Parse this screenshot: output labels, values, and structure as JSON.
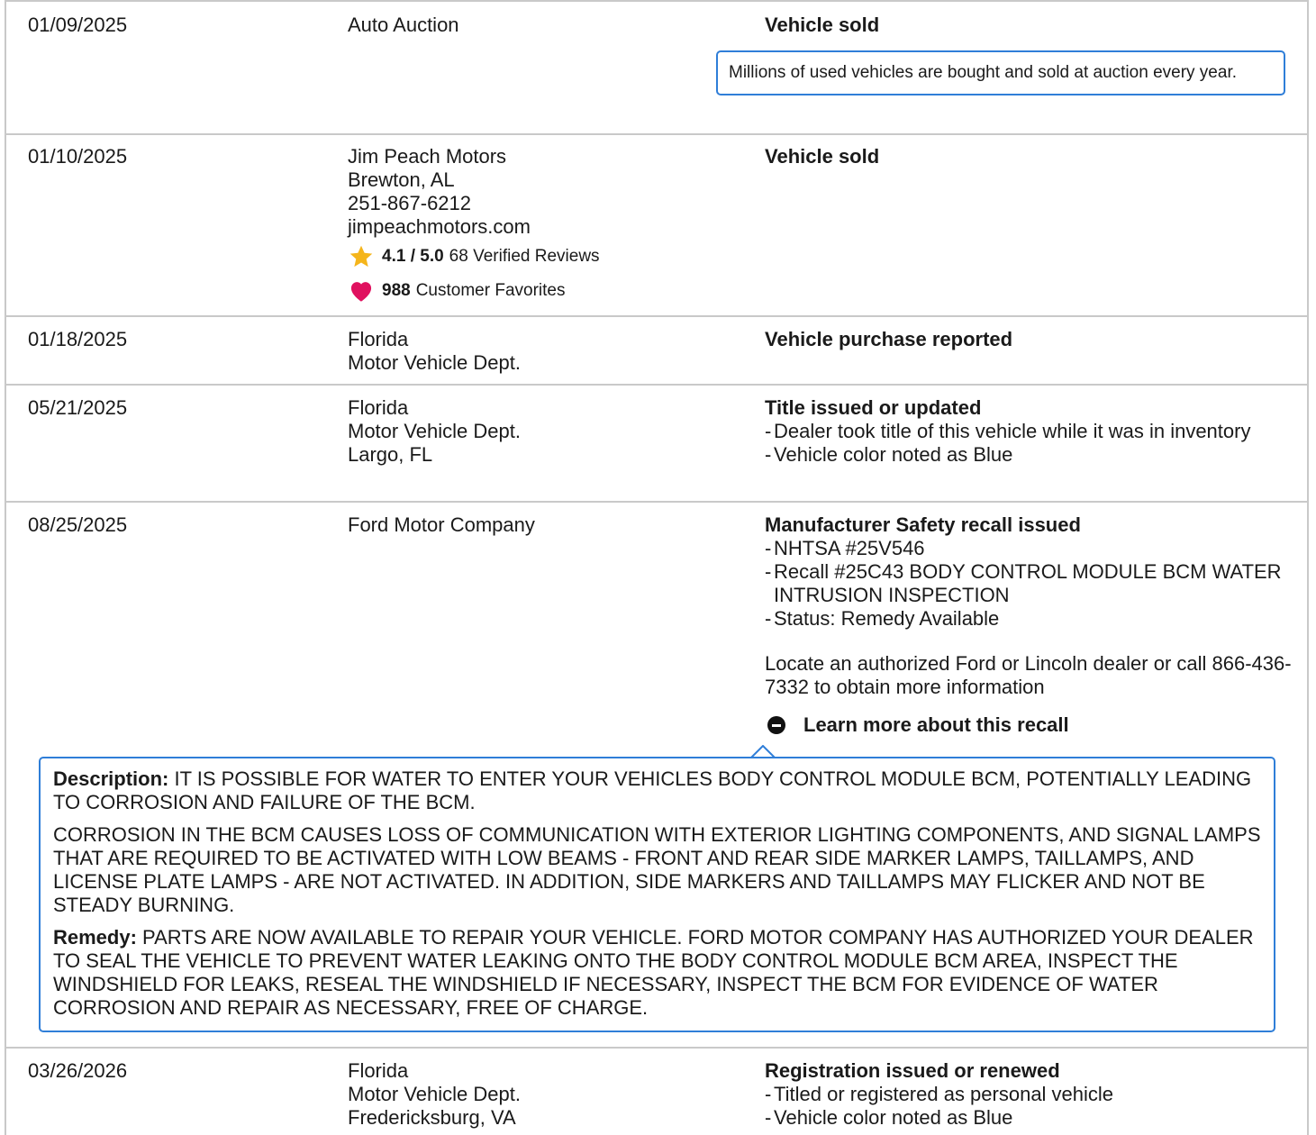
{
  "rows": [
    {
      "date": "01/09/2025",
      "source": [
        "Auto Auction"
      ],
      "title": "Vehicle sold",
      "note": "Millions of used vehicles are bought and sold at auction every year."
    },
    {
      "date": "01/10/2025",
      "source": [
        "Jim Peach Motors",
        "Brewton, AL",
        "251-867-6212",
        "jimpeachmotors.com"
      ],
      "rating": "4.1 / 5.0",
      "reviews": "68 Verified Reviews",
      "favorites_count": "988",
      "favorites_label": "Customer Favorites",
      "title": "Vehicle sold"
    },
    {
      "date": "01/18/2025",
      "source": [
        "Florida",
        "Motor Vehicle Dept."
      ],
      "title": "Vehicle purchase reported"
    },
    {
      "date": "05/21/2025",
      "source": [
        "Florida",
        "Motor Vehicle Dept.",
        "Largo, FL"
      ],
      "title": "Title issued or updated",
      "bullets": [
        "Dealer took title of this vehicle while it was in inventory",
        "Vehicle color noted as Blue"
      ]
    },
    {
      "date": "08/25/2025",
      "source": [
        "Ford Motor Company"
      ],
      "title": "Manufacturer Safety recall issued",
      "bullets": [
        "NHTSA #25V546",
        "Recall #25C43 BODY CONTROL MODULE BCM WATER INTRUSION INSPECTION",
        "Status: Remedy Available"
      ],
      "extra": "Locate an authorized Ford or Lincoln dealer or call 866-436-7332 to obtain more information",
      "learn_more": "Learn more about this recall",
      "description_label": "Description:",
      "description": "IT IS POSSIBLE FOR WATER TO ENTER YOUR VEHICLES BODY CONTROL MODULE BCM, POTENTIALLY LEADING TO CORROSION AND FAILURE OF THE BCM.",
      "description_2": "CORROSION IN THE BCM CAUSES LOSS OF COMMUNICATION WITH EXTERIOR LIGHTING COMPONENTS, AND SIGNAL LAMPS THAT ARE REQUIRED TO BE ACTIVATED WITH LOW BEAMS - FRONT AND REAR SIDE MARKER LAMPS, TAILLAMPS, AND LICENSE PLATE LAMPS - ARE NOT ACTIVATED. IN ADDITION, SIDE MARKERS AND TAILLAMPS MAY FLICKER AND NOT BE STEADY BURNING.",
      "remedy_label": "Remedy:",
      "remedy": "PARTS ARE NOW AVAILABLE TO REPAIR YOUR VEHICLE. FORD MOTOR COMPANY HAS AUTHORIZED YOUR DEALER TO SEAL THE VEHICLE TO PREVENT WATER LEAKING ONTO THE BODY CONTROL MODULE BCM AREA, INSPECT THE WINDSHIELD FOR LEAKS, RESEAL THE WINDSHIELD IF NECESSARY, INSPECT THE BCM FOR EVIDENCE OF WATER CORROSION AND REPAIR AS NECESSARY, FREE OF CHARGE."
    },
    {
      "date": "03/26/2026",
      "source": [
        "Florida",
        "Motor Vehicle Dept.",
        "Fredericksburg, VA"
      ],
      "title": "Registration issued or renewed",
      "bullets": [
        "Titled or registered as personal vehicle",
        "Vehicle color noted as Blue"
      ]
    }
  ],
  "colors": {
    "border": "#c9c9c9",
    "accent_blue": "#2f7ed8",
    "star": "#f5b51b",
    "heart": "#e0115f"
  },
  "icons": {
    "rating": "star-icon",
    "favorites": "heart-icon",
    "collapse": "minus-circle-icon"
  }
}
